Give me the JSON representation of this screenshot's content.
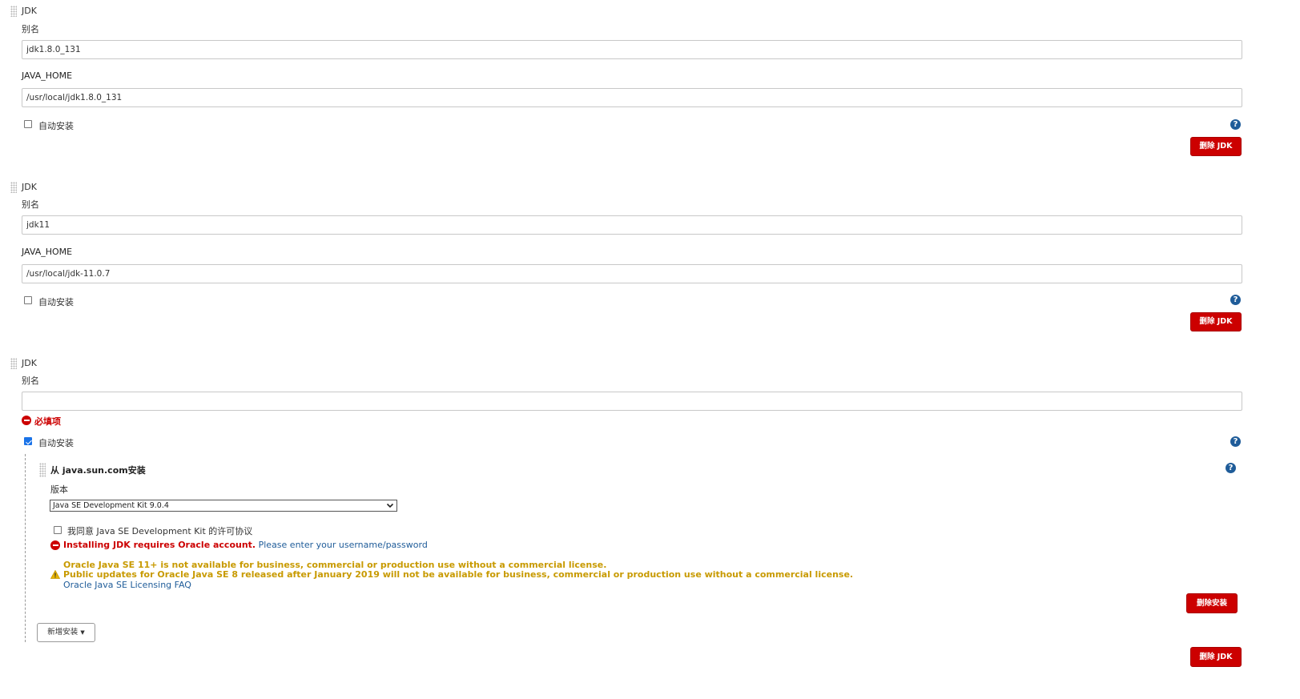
{
  "jdk_blocks": [
    {
      "section_title": "JDK",
      "alias_label": "别名",
      "alias_value": "jdk1.8.0_131",
      "java_home_label": "JAVA_HOME",
      "java_home_value": "/usr/local/jdk1.8.0_131",
      "auto_install_label": "自动安装",
      "auto_install_checked": false,
      "help_glyph": "?",
      "delete_label": "删除 JDK"
    },
    {
      "section_title": "JDK",
      "alias_label": "别名",
      "alias_value": "jdk11",
      "java_home_label": "JAVA_HOME",
      "java_home_value": "/usr/local/jdk-11.0.7",
      "auto_install_label": "自动安装",
      "auto_install_checked": false,
      "help_glyph": "?",
      "delete_label": "删除 JDK"
    },
    {
      "section_title": "JDK",
      "alias_label": "别名",
      "alias_value": "",
      "required_error": "必填项",
      "auto_install_label": "自动安装",
      "auto_install_checked": true,
      "help_glyph": "?",
      "delete_label": "删除 JDK"
    }
  ],
  "installer": {
    "title": "从 java.sun.com安装",
    "help_glyph": "?",
    "version_label": "版本",
    "version_selected": "Java SE Development Kit 9.0.4",
    "license_label": "我同意 Java SE Development Kit 的许可协议",
    "license_checked": false,
    "oracle_error": "Installing JDK requires Oracle account.",
    "oracle_link": "Please enter your username/password",
    "warning_line1": "Oracle Java SE 11+ is not available for business, commercial or production use without a commercial license.",
    "warning_line2": "Public updates for Oracle Java SE 8 released after January 2019 will not be available for business, commercial or production use without a commercial license.",
    "faq_link": "Oracle Java SE Licensing FAQ",
    "delete_installer_label": "删除安装",
    "add_installer_label": "新增安装"
  },
  "colors": {
    "danger": "#cc0000",
    "help": "#1f5c99",
    "warning": "#c89a00",
    "checkbox_checked": "#1a73e8"
  },
  "icons": {
    "help": "question-circle-icon",
    "error": "error-circle-icon",
    "warning": "warning-triangle-icon",
    "drag": "drag-handle-icon",
    "dropdown": "chevron-down-icon",
    "caret": "caret-down-icon"
  }
}
